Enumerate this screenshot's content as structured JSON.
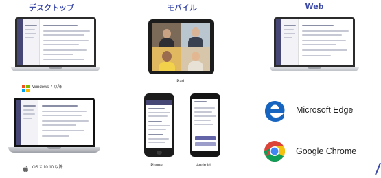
{
  "columns": {
    "desktop": "デスクトップ",
    "mobile": "モバイル",
    "web": "Web"
  },
  "devices": {
    "windows_label": "Windows 7 以降",
    "mac_label": "OS X 10.10 以降",
    "ipad_label": "iPad",
    "iphone_label": "iPhone",
    "android_label": "Android"
  },
  "browsers": {
    "edge": "Microsoft Edge",
    "chrome": "Google Chrome"
  },
  "colors": {
    "accent": "#3d4ba8",
    "teams_purple": "#464775",
    "edge_blue": "#1565c0",
    "chrome_red": "#db4437",
    "chrome_yellow": "#f4c20d",
    "chrome_green": "#0f9d58",
    "chrome_blue": "#4285f4"
  },
  "icons": [
    "windows-logo-icon",
    "apple-logo-icon",
    "edge-logo-icon",
    "chrome-logo-icon"
  ]
}
